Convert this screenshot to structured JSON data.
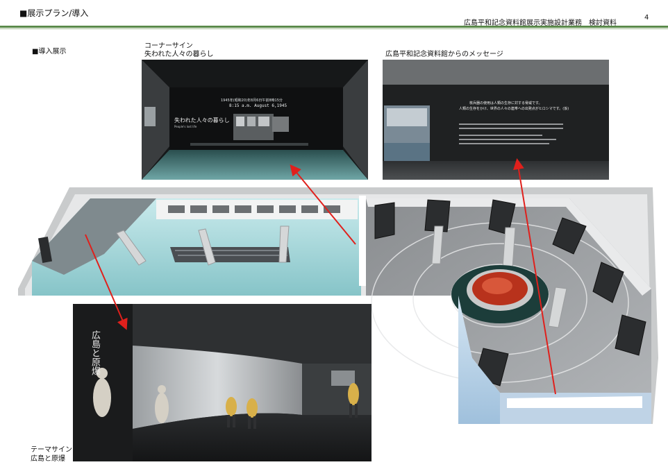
{
  "header": {
    "section_title": "■展示プラン/導入",
    "document_title": "広島平和記念資料館展示実施設計業務　検討資料",
    "page_number": "4"
  },
  "labels": {
    "intro_exhibit": "■導入展示",
    "corner_sign_line1": "コーナーサイン",
    "corner_sign_line2": "失われた人々の暮らし",
    "message_label": "広島平和記念資料館からのメッセージ",
    "theme_sign_line1": "テーマサイン",
    "theme_sign_line2": "広島と原爆"
  },
  "render_corner": {
    "date_line": "1945年(昭和20)年8月6日午前8時15分",
    "time_line": "8:15 a.m. August 6,1945",
    "wall_title": "失われた人々の暮らし",
    "wall_subtitle": "People's lost life"
  },
  "render_message": {
    "message_line1": "核兵器の使用は人類の生存に対する脅威です。",
    "message_line2": "人類の生存をかけ、世界の人々の連帯への出発点がヒロシマです。(仮)"
  },
  "render_theme": {
    "wall_title": "広島と原爆"
  },
  "colors": {
    "arrow": "#e0201c",
    "header_rule": "#5a8a4a"
  }
}
